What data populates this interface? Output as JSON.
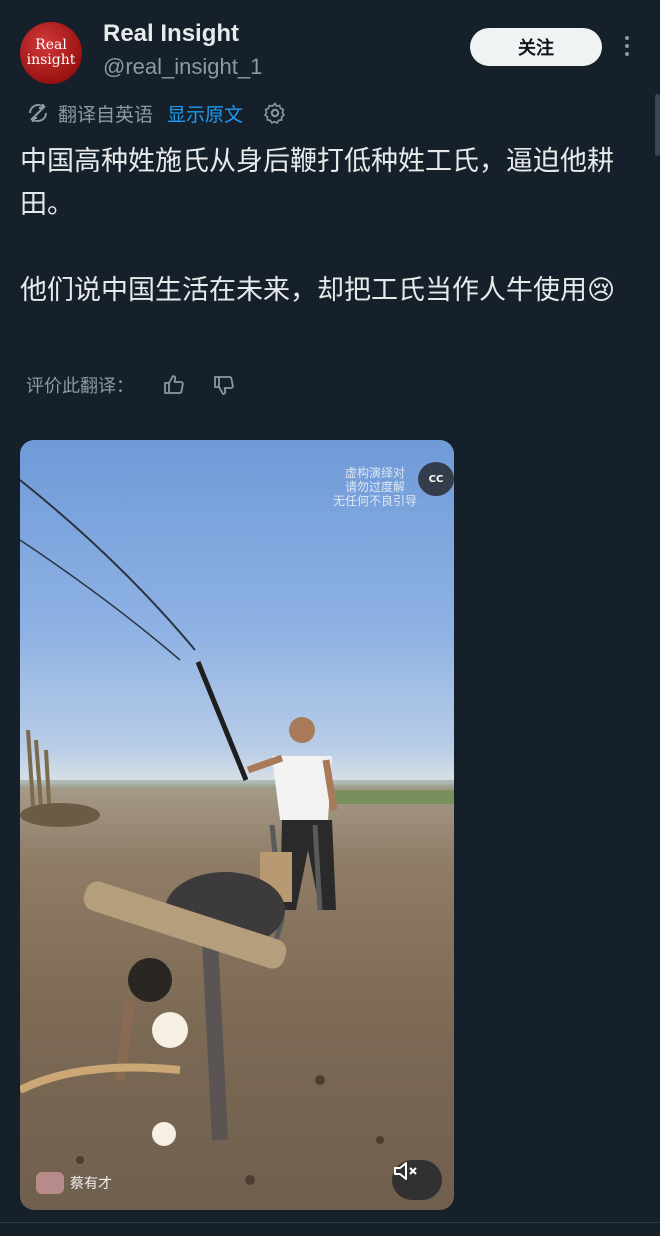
{
  "author": {
    "avatar_line1": "Real",
    "avatar_line2": "insight",
    "name": "Real Insight",
    "handle": "@real_insight_1"
  },
  "follow_label": "关注",
  "translation": {
    "label": "翻译自英语",
    "show_original": "显示原文"
  },
  "tweet_text": "中国高种姓施氏从身后鞭打低种姓工氏，逼迫他耕田。\n\n他们说中国生活在未来，却把工氏当作人牛使用😢",
  "rate": {
    "label": "评价此翻译："
  },
  "media": {
    "overlay_text": "虚构演绎对\n请勿过度解\n无任何不良引导",
    "cc_label": "CC",
    "creator_name": "蔡有才"
  },
  "colors": {
    "background": "#15202b",
    "link": "#1d9bf0",
    "muted": "#8b98a5"
  }
}
